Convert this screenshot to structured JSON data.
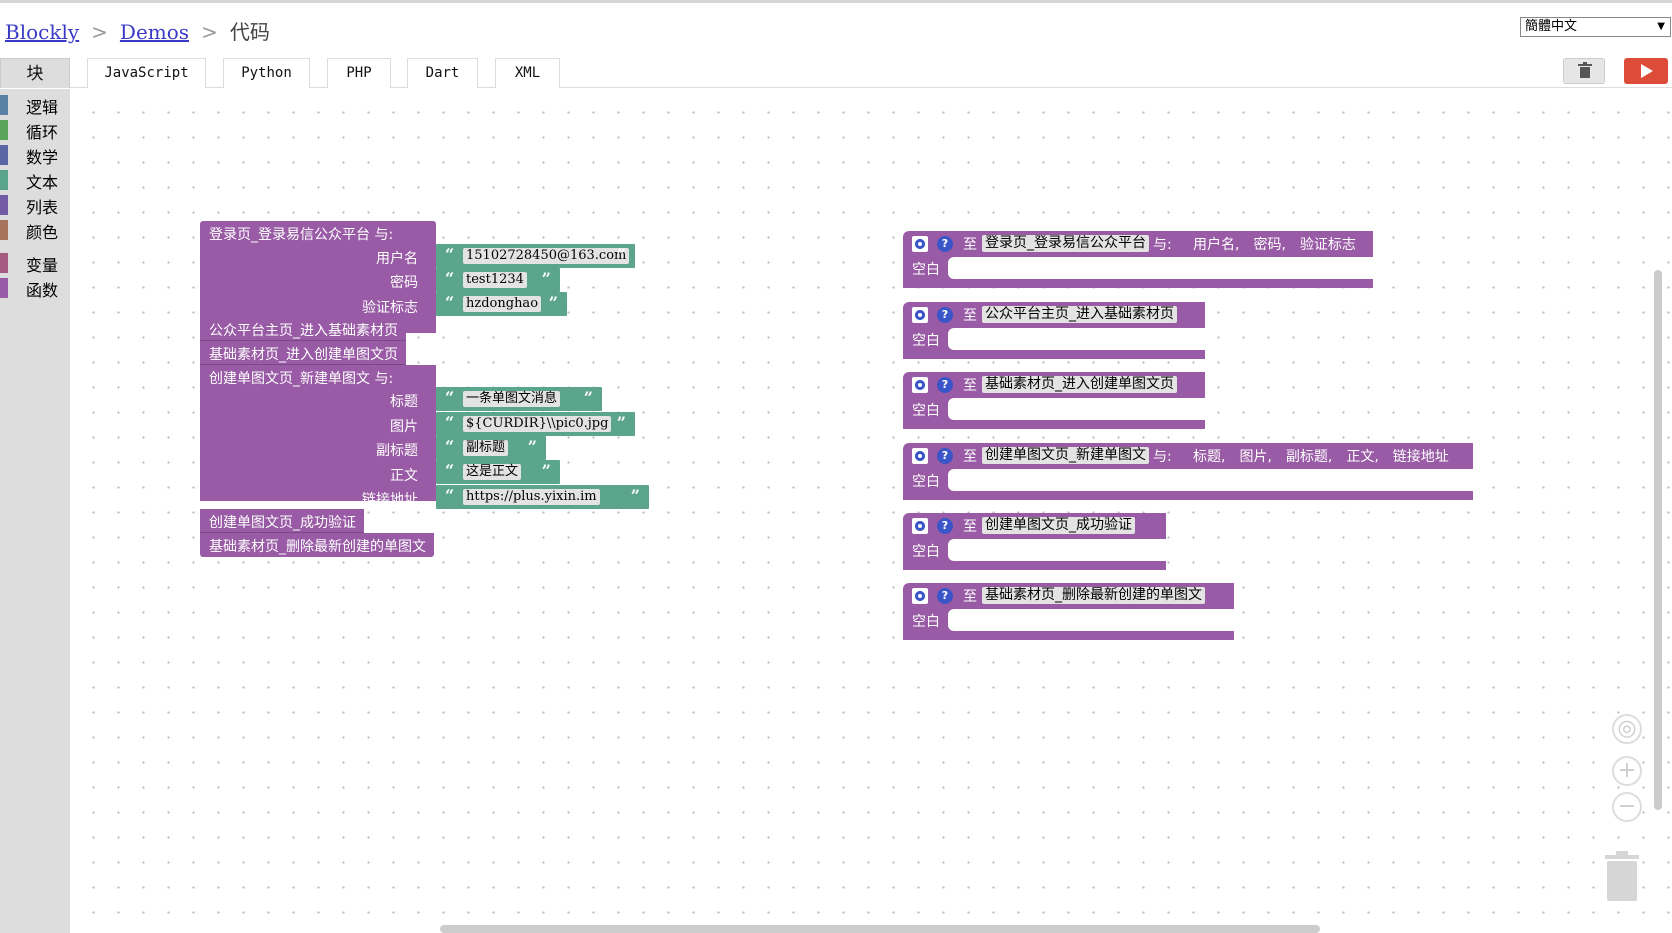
{
  "header": {
    "crumb_root": "Blockly",
    "crumb_demos": "Demos",
    "crumb_current": "代码",
    "sep": ">",
    "language": "簡體中文"
  },
  "tabs": [
    "块",
    "JavaScript",
    "Python",
    "PHP",
    "Dart",
    "XML"
  ],
  "toolbox": [
    {
      "label": "逻辑",
      "color": "#5b80a5"
    },
    {
      "label": "循环",
      "color": "#5ba55b"
    },
    {
      "label": "数学",
      "color": "#5b67a5"
    },
    {
      "label": "文本",
      "color": "#5ba58c"
    },
    {
      "label": "列表",
      "color": "#745ba5"
    },
    {
      "label": "颜色",
      "color": "#a5745b"
    },
    {
      "label": "变量",
      "color": "#a55b80"
    },
    {
      "label": "函数",
      "color": "#995ba5"
    }
  ],
  "colors": {
    "procedure": "#995ba5",
    "text": "#5ba58c",
    "run": "#dd4b39"
  },
  "left_stack": {
    "call1": {
      "title": "登录页_登录易信公众平台 与:",
      "args": [
        {
          "label": "用户名",
          "value": "15102728450@163.com"
        },
        {
          "label": "密码",
          "value": "test1234"
        },
        {
          "label": "验证标志",
          "value": "hzdonghao"
        }
      ]
    },
    "call2": "公众平台主页_进入基础素材页",
    "call3": "基础素材页_进入创建单图文页",
    "call4": {
      "title": "创建单图文页_新建单图文 与:",
      "args": [
        {
          "label": "标题",
          "value": "一条单图文消息"
        },
        {
          "label": "图片",
          "value": "${CURDIR}\\\\pic0.jpg"
        },
        {
          "label": "副标题",
          "value": "副标题"
        },
        {
          "label": "正文",
          "value": "这是正文"
        },
        {
          "label": "链接地址",
          "value": "https://plus.yixin.im"
        }
      ]
    },
    "call5": "创建单图文页_成功验证",
    "call6": "基础素材页_删除最新创建的单图文"
  },
  "definitions": [
    {
      "to": "至",
      "name": "登录页_登录易信公众平台",
      "with": "与:",
      "params": "用户名,　密码,　验证标志",
      "body": "空白"
    },
    {
      "to": "至",
      "name": "公众平台主页_进入基础素材页",
      "with": "",
      "params": "",
      "body": "空白"
    },
    {
      "to": "至",
      "name": "基础素材页_进入创建单图文页",
      "with": "",
      "params": "",
      "body": "空白"
    },
    {
      "to": "至",
      "name": "创建单图文页_新建单图文",
      "with": "与:",
      "params": "标题,　图片,　副标题,　正文,　链接地址",
      "body": "空白"
    },
    {
      "to": "至",
      "name": "创建单图文页_成功验证",
      "with": "",
      "params": "",
      "body": "空白"
    },
    {
      "to": "至",
      "name": "基础素材页_删除最新创建的单图文",
      "with": "",
      "params": "",
      "body": "空白"
    }
  ],
  "quote_open": "“",
  "quote_close": "”",
  "help_glyph": "?"
}
